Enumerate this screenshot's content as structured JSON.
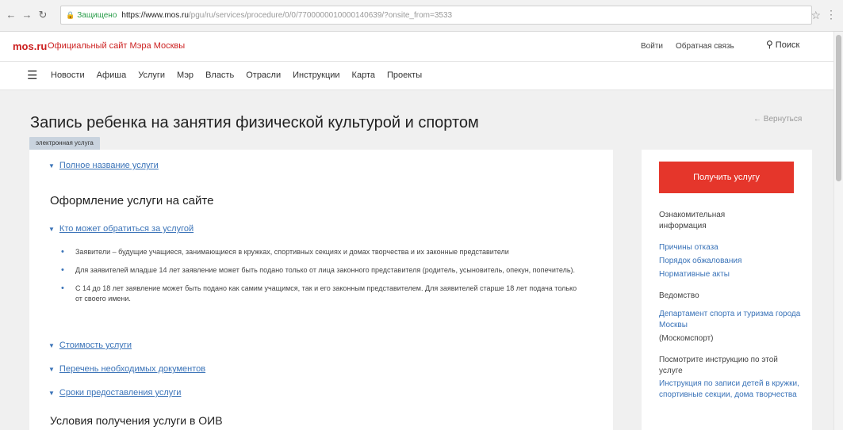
{
  "browser": {
    "secure_label": "Защищено",
    "url_host": "https://www.mos.ru",
    "url_path": "/pgu/ru/services/procedure/0/0/7700000010000140639/?onsite_from=3533"
  },
  "header": {
    "logo": "mos.ru",
    "site_title": "Официальный сайт Мэра Москвы",
    "login": "Войти",
    "feedback": "Обратная связь",
    "search": "Поиск"
  },
  "nav": {
    "items": [
      "Новости",
      "Афиша",
      "Услуги",
      "Мэр",
      "Власть",
      "Отрасли",
      "Инструкции",
      "Карта",
      "Проекты"
    ]
  },
  "page": {
    "title": "Запись ребенка на занятия физической культурой и спортом",
    "back": "Вернуться",
    "tag": "электронная услуга"
  },
  "main": {
    "full_name_link": "Полное название услуги",
    "section1_heading": "Оформление услуги на сайте",
    "who_can_link": "Кто может обратиться за услугой",
    "bullets": [
      "Заявители – будущие учащиеся, занимающиеся в кружках, спортивных секциях и домах творчества и их законные представители",
      "Для заявителей младше 14 лет заявление может быть подано только от лица законного представителя (родитель, усыновитель, опекун, попечитель).",
      "С 14 до 18 лет заявление может быть подано как самим учащимся, так и его законным представителем. Для заявителей старше 18 лет подача только от своего имени."
    ],
    "cost_link": "Стоимость услуги",
    "docs_link": "Перечень необходимых документов",
    "terms_link": "Сроки предоставления услуги",
    "section2_heading": "Условия получения услуги в ОИВ"
  },
  "sidebar": {
    "get_service": "Получить услугу",
    "info_label": "Ознакомительная информация",
    "info_links": [
      "Причины отказа",
      "Порядок обжалования",
      "Нормативные акты"
    ],
    "agency_label": "Ведомство",
    "agency_link": "Департамент спорта и туризма города Москвы",
    "agency_short": "(Москомспорт)",
    "instruction_label": "Посмотрите инструкцию по этой услуге",
    "instruction_link": "Инструкция по записи детей в кружки, спортивные секции, дома творчества"
  }
}
